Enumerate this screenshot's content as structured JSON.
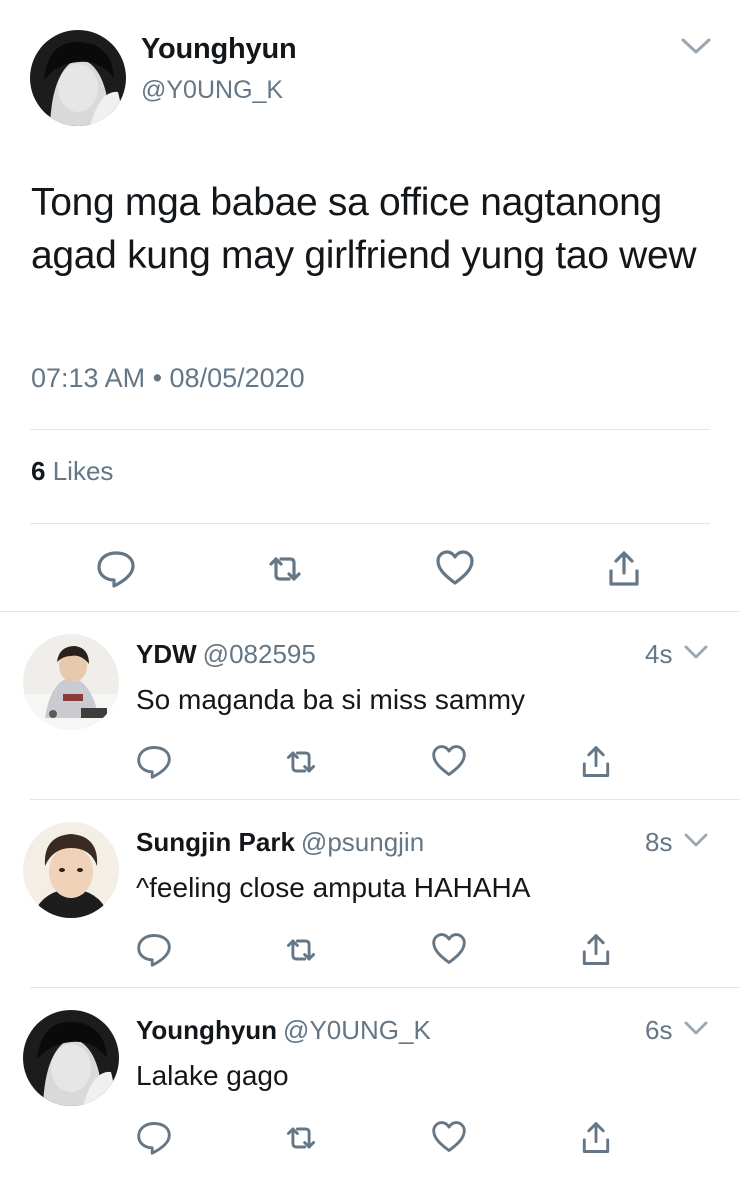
{
  "main_tweet": {
    "author_name": "Younghyun",
    "author_handle": "@Y0UNG_K",
    "text": "Tong mga babae sa office nagtanong agad kung may girlfriend yung tao wew",
    "timestamp": "07:13 AM • 08/05/2020",
    "likes_count": "6",
    "likes_label": "Likes",
    "actions": [
      "reply-icon",
      "retweet-icon",
      "like-icon",
      "share-icon"
    ]
  },
  "replies": [
    {
      "name": "YDW",
      "handle": "@082595",
      "time": "4s",
      "text": "So maganda ba si miss sammy"
    },
    {
      "name": "Sungjin Park",
      "handle": "@psungjin",
      "time": "8s",
      "text": "^feeling close amputa HAHAHA"
    },
    {
      "name": "Younghyun",
      "handle": "@Y0UNG_K",
      "time": "6s",
      "text": "Lalake gago"
    }
  ],
  "colors": {
    "text_primary": "#14171a",
    "text_secondary": "#657786",
    "divider": "#e1e8ed"
  }
}
